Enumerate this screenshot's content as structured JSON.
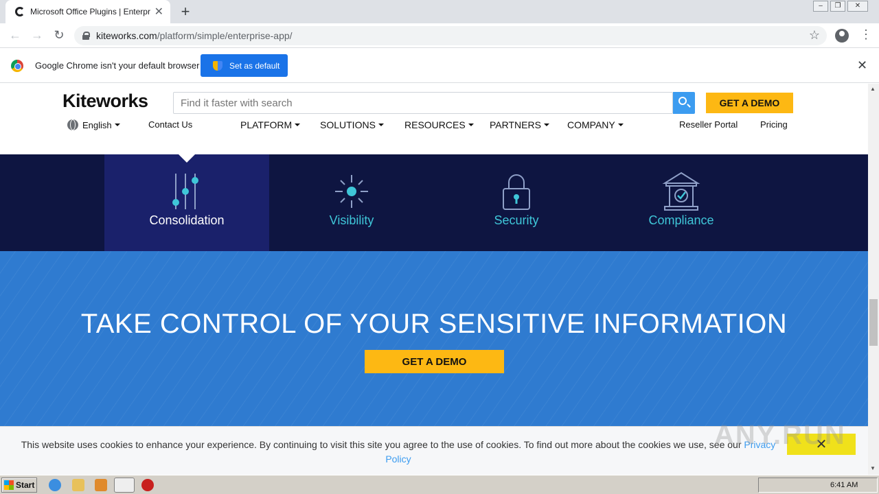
{
  "browser": {
    "tab_title": "Microsoft Office Plugins | Enterprise",
    "url_host": "kiteworks.com",
    "url_path": "/platform/simple/enterprise-app/",
    "infobar_text": "Google Chrome isn't your default browser",
    "set_default_label": "Set as default"
  },
  "site": {
    "logo": "Kiteworks",
    "search_placeholder": "Find it faster with search",
    "header_demo": "GET A DEMO",
    "language": "English",
    "contact": "Contact Us",
    "nav": [
      "PLATFORM",
      "SOLUTIONS",
      "RESOURCES",
      "PARTNERS",
      "COMPANY"
    ],
    "reseller": "Reseller Portal",
    "pricing": "Pricing"
  },
  "features": [
    {
      "label": "Consolidation",
      "icon": "sliders-icon",
      "active": true
    },
    {
      "label": "Visibility",
      "icon": "sun-icon",
      "active": false
    },
    {
      "label": "Security",
      "icon": "padlock-icon",
      "active": false
    },
    {
      "label": "Compliance",
      "icon": "courthouse-check-icon",
      "active": false
    }
  ],
  "cta": {
    "title": "TAKE CONTROL OF YOUR SENSITIVE INFORMATION",
    "button": "GET A DEMO"
  },
  "cookie": {
    "text_1": "This website uses cookies to enhance your experience. By continuing to visit this site you agree to the use of cookies. To find out more about the cookies we use, see our ",
    "link": "Privacy Policy",
    "close": "✕"
  },
  "watermark": "ANY.RUN",
  "taskbar": {
    "start": "Start",
    "clock": "6:41 AM"
  },
  "colors": {
    "accent_yellow": "#fdb813",
    "band_dark": "#0e1541",
    "cta_blue": "#2f7bd0",
    "feature_cyan": "#3fc6d8"
  }
}
